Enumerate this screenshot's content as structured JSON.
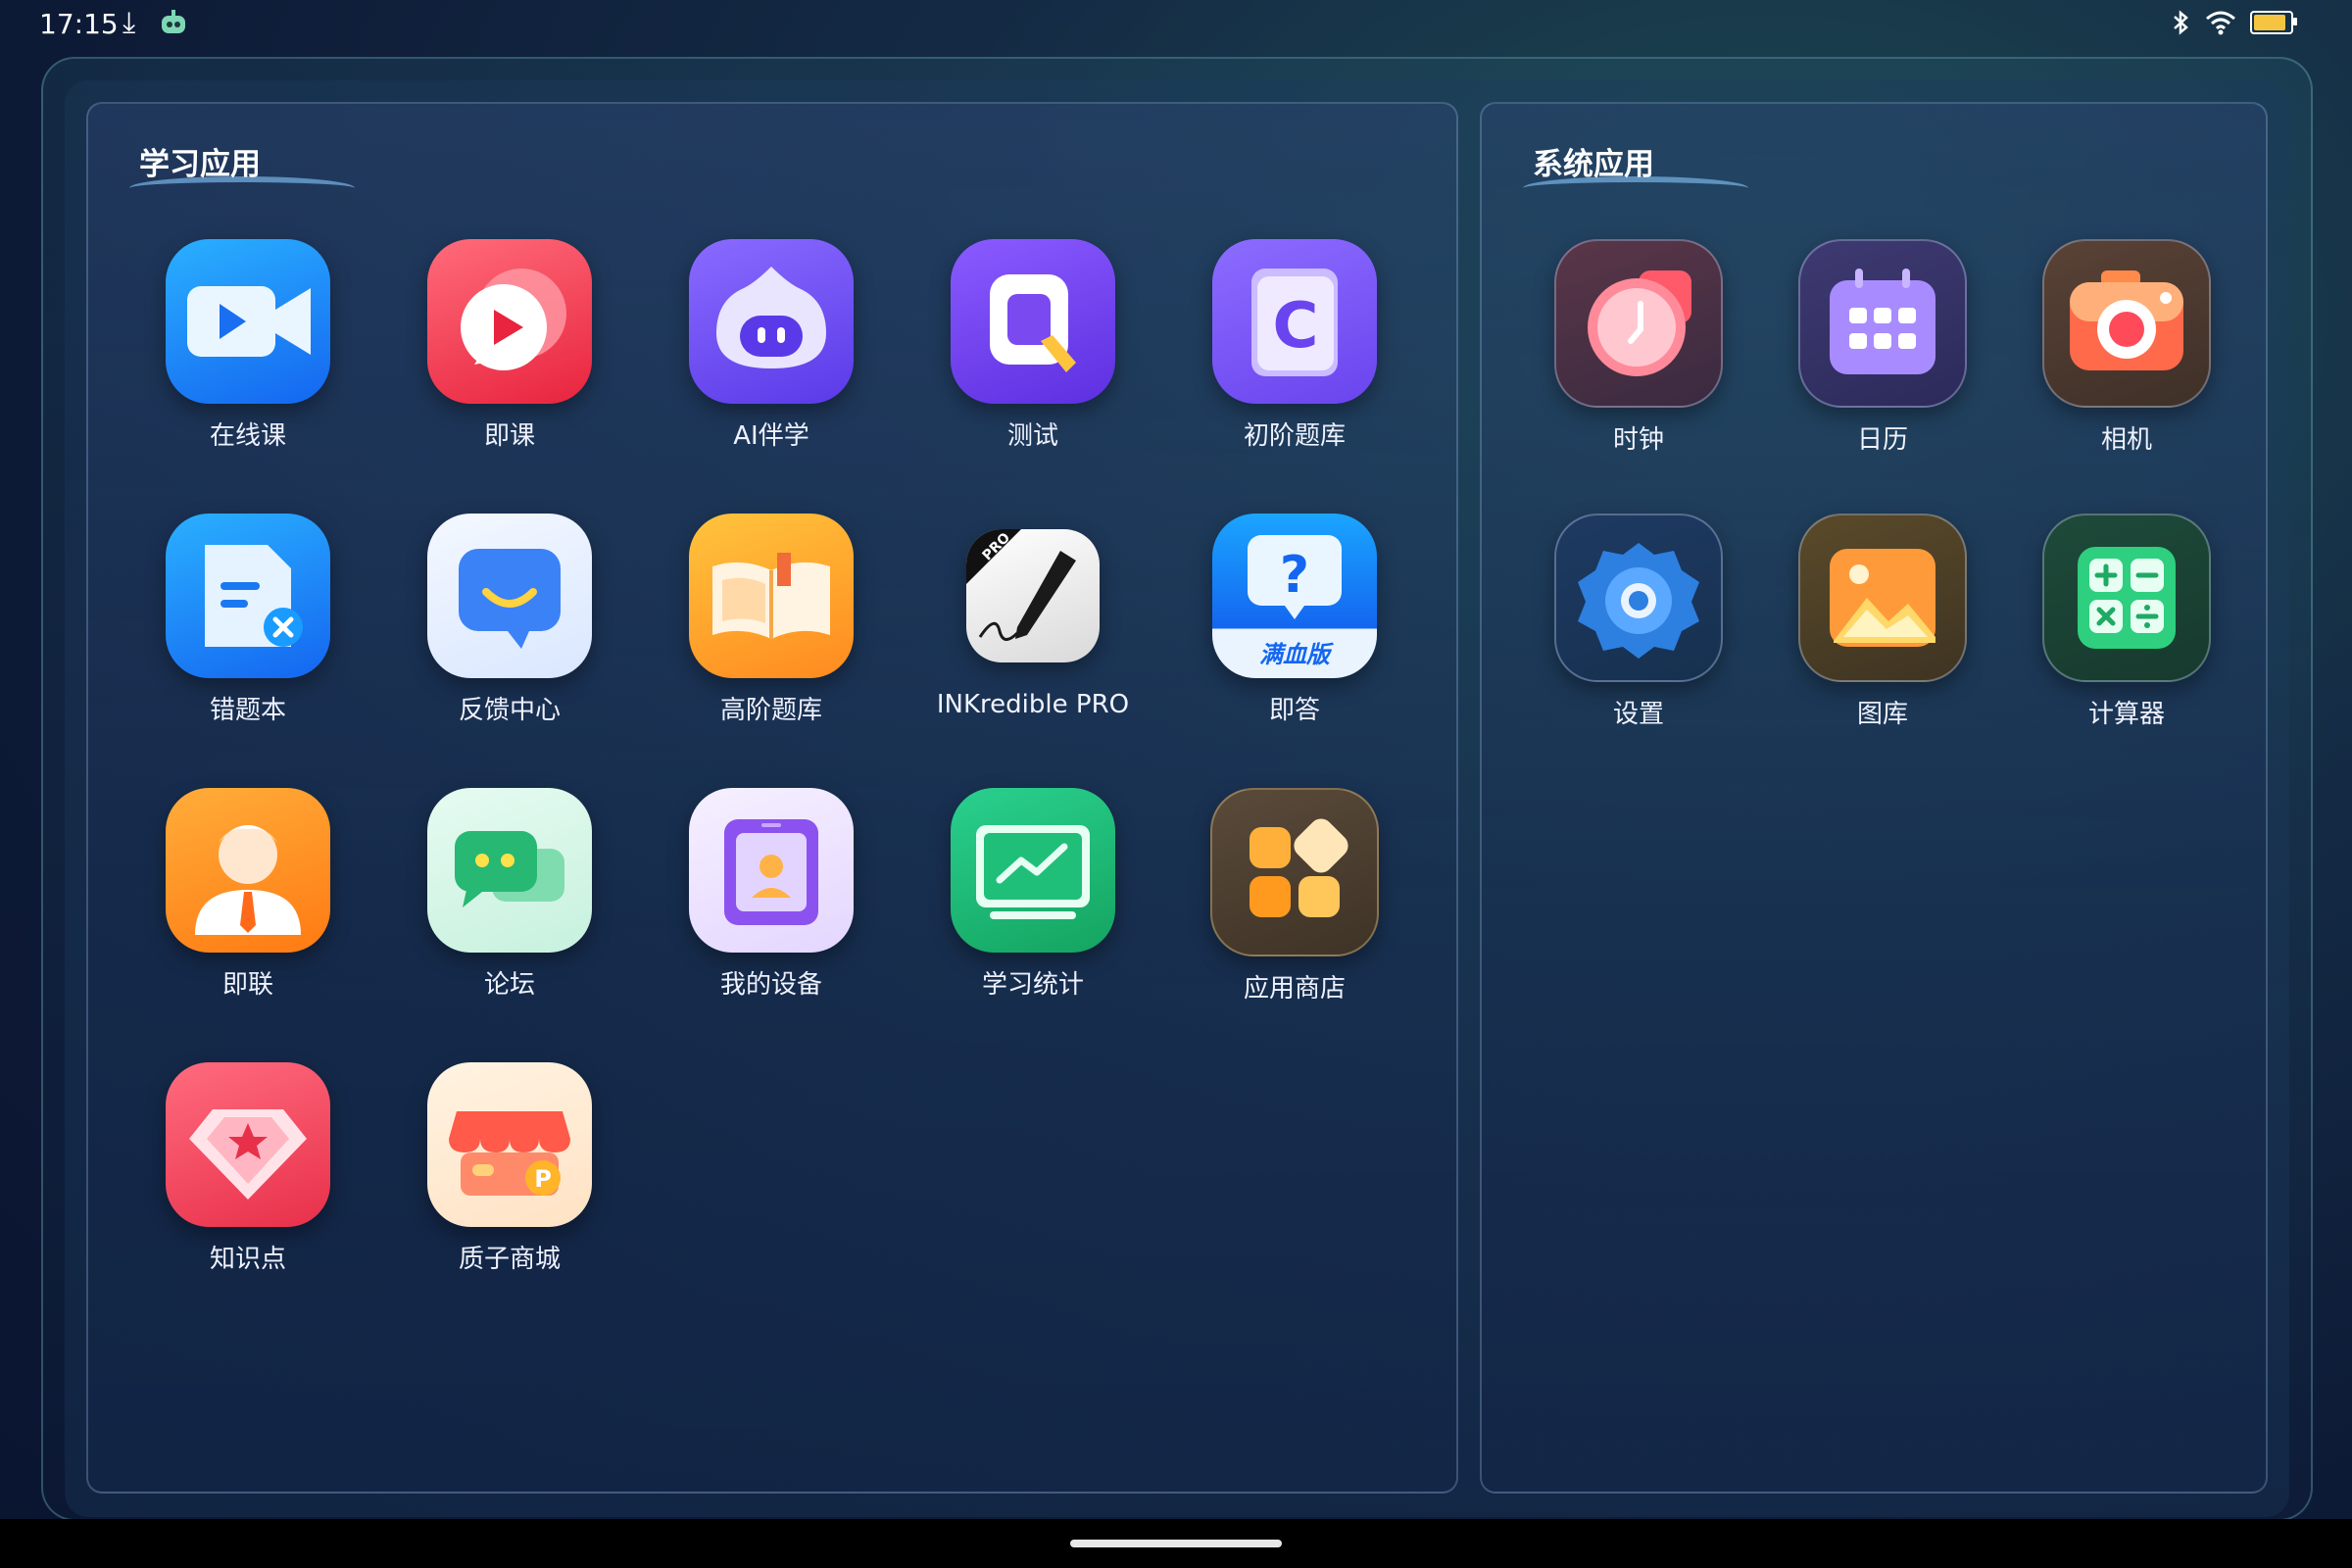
{
  "status": {
    "time": "17:15",
    "battery_level": 0.9
  },
  "sections": {
    "learning": {
      "title": "学习应用"
    },
    "system": {
      "title": "系统应用"
    }
  },
  "apps": {
    "online_class": "在线课",
    "jike": "即课",
    "ai_study": "AI伴学",
    "test": "测试",
    "basic_bank": "初阶题库",
    "mistakes": "错题本",
    "feedback": "反馈中心",
    "advanced_bank": "高阶题库",
    "inkredible": "INKredible PRO",
    "inkredible_badge": "PRO",
    "jida": "即答",
    "jida_badge": "满血版",
    "jilian": "即联",
    "forum": "论坛",
    "my_device": "我的设备",
    "stats": "学习统计",
    "app_store": "应用商店",
    "knowledge": "知识点",
    "mall": "质子商城",
    "mall_badge": "P",
    "clock": "时钟",
    "calendar": "日历",
    "camera": "相机",
    "settings": "设置",
    "gallery": "图库",
    "calculator": "计算器"
  }
}
